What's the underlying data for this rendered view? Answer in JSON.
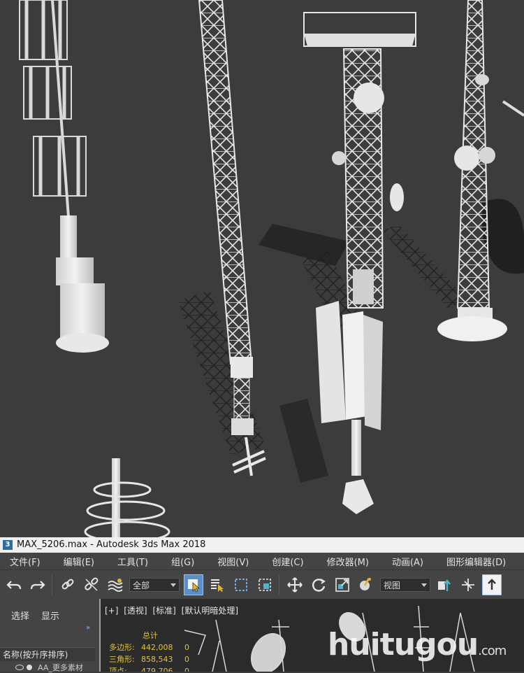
{
  "window": {
    "title": "MAX_5206.max - Autodesk 3ds Max 2018",
    "app_icon": "3"
  },
  "menu": [
    "文件(F)",
    "编辑(E)",
    "工具(T)",
    "组(G)",
    "视图(V)",
    "创建(C)",
    "修改器(M)",
    "动画(A)",
    "图形编辑器(D)"
  ],
  "toolbar": {
    "selection_filter": "全部",
    "coordinate_system": "视图"
  },
  "explorer": {
    "tabs": [
      "选择",
      "显示"
    ],
    "more_icon": "»",
    "column_header": "名称(按升序排序)",
    "row_label": "AA_更多素材"
  },
  "viewport": {
    "labels": [
      "[+]",
      "[透视]",
      "[标准]",
      "[默认明暗处理]"
    ],
    "stats": {
      "header": "总计",
      "rows": [
        {
          "label": "多边形:",
          "value": "442,008",
          "extra": "0"
        },
        {
          "label": "三角形:",
          "value": "858,543",
          "extra": "0"
        },
        {
          "label": "顶点:",
          "value": "479,706",
          "extra": "0"
        }
      ]
    }
  },
  "watermark": {
    "brand": "huitugou",
    "suffix": ".com"
  },
  "colors": {
    "render_bg": "#3c3c3c",
    "ui_dark": "#444444",
    "stats_yellow": "#e2c33a",
    "active_blue": "#5b8fc7"
  }
}
